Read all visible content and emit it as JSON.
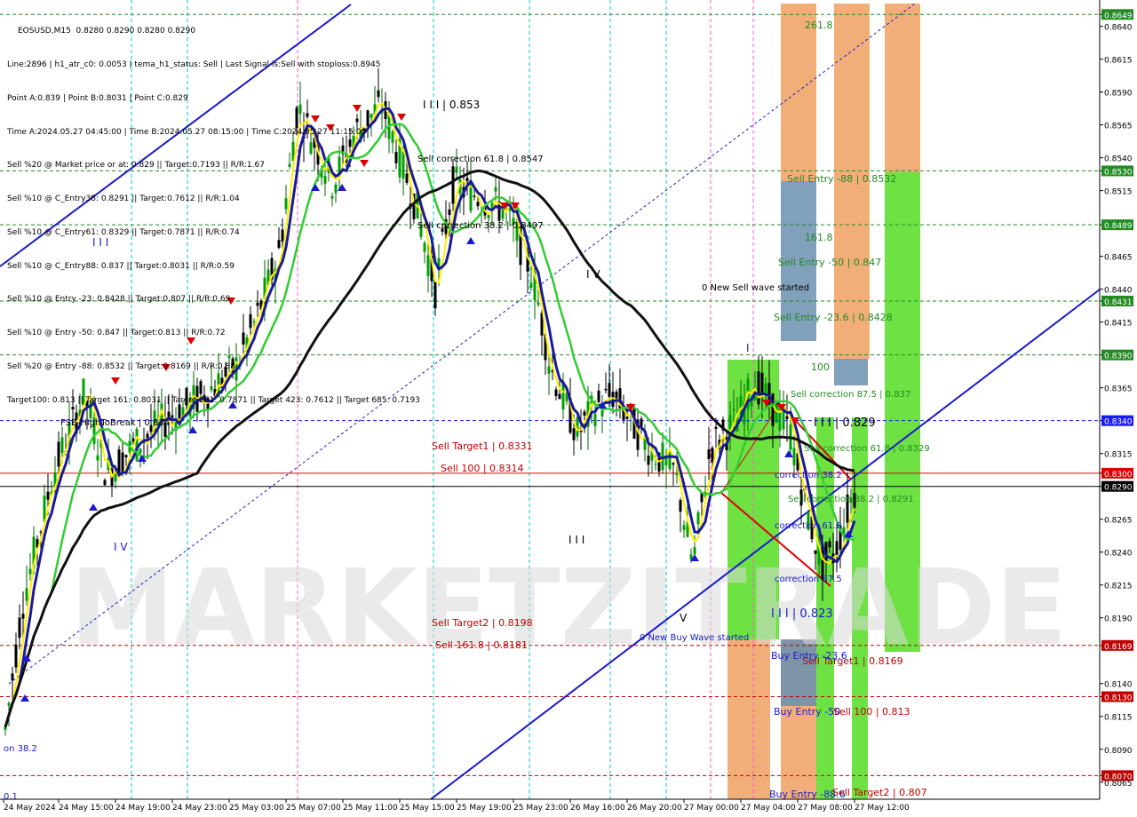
{
  "symbol_header": "EOSUSD,M15  0.8280 0.8290 0.8280 0.8290",
  "info_lines": [
    "Line:2896 | h1_atr_c0: 0.0053 | tema_h1_status: Sell | Last Signal is:Sell with stoploss:0.8945",
    "Point A:0.839 | Point B:0.8031 | Point C:0.829",
    "Time A:2024.05.27 04:45:00 | Time B:2024.05.27 08:15:00 | Time C:2024.05.27 11:15:00",
    "Sell %20 @ Market price or at: 0.829 || Target:0.7193 || R/R:1.67",
    "Sell %10 @ C_Entry38: 0.8291 || Target:0.7612 || R/R:1.04",
    "Sell %10 @ C_Entry61: 0.8329 || Target:0.7871 || R/R:0.74",
    "Sell %10 @ C_Entry88: 0.837 || Target:0.8031 || R/R:0.59",
    "Sell %10 @ Entry -23: 0.8428 || Target:0.807 || R/R:0.69",
    "Sell %10 @ Entry -50: 0.847 || Target:0.813 || R/R:0.72",
    "Sell %20 @ Entry -88: 0.8532 || Target:0.8169 || R/R:0.88",
    "Target100: 0.813 || Target 161: 0.8031 || Target 261: 0.7871 || Target 423: 0.7612 || Target 685: 0.7193"
  ],
  "watermark": "MARKETZITRADE",
  "chart_data": {
    "type": "candlestick",
    "title": "EOSUSD,M15",
    "ylim": [
      0.8052,
      0.866
    ],
    "y_ticks": [
      "0.8649",
      "0.8640",
      "0.8615",
      "0.8590",
      "0.8565",
      "0.8540",
      "0.8530",
      "0.8515",
      "0.8489",
      "0.8465",
      "0.8440",
      "0.8431",
      "0.8415",
      "0.8390",
      "0.8365",
      "0.8340",
      "0.8315",
      "0.8300",
      "0.8290",
      "0.8265",
      "0.8240",
      "0.8215",
      "0.8190",
      "0.8169",
      "0.8140",
      "0.8130",
      "0.8115",
      "0.8090",
      "0.8070",
      "0.8065"
    ],
    "x_ticks": [
      "24 May 2024",
      "24 May 15:00",
      "24 May 19:00",
      "24 May 23:00",
      "25 May 03:00",
      "25 May 07:00",
      "25 May 11:00",
      "25 May 15:00",
      "25 May 19:00",
      "25 May 23:00",
      "26 May 16:00",
      "26 May 20:00",
      "27 May 00:00",
      "27 May 04:00",
      "27 May 08:00",
      "27 May 12:00"
    ],
    "price_levels": [
      {
        "value": 0.8649,
        "color": "#228b22",
        "highlight": true
      },
      {
        "value": 0.853,
        "color": "#228b22",
        "highlight": true
      },
      {
        "value": 0.8489,
        "color": "#228b22",
        "highlight": true
      },
      {
        "value": 0.8431,
        "color": "#228b22",
        "highlight": true
      },
      {
        "value": 0.839,
        "color": "#228b22",
        "highlight": true
      },
      {
        "value": 0.834,
        "color": "#1a1aff",
        "highlight": true
      },
      {
        "value": 0.83,
        "color": "#e00000",
        "highlight": true
      },
      {
        "value": 0.829,
        "color": "#000000",
        "highlight": true
      },
      {
        "value": 0.8169,
        "color": "#c00000",
        "highlight": true
      },
      {
        "value": 0.813,
        "color": "#c00000",
        "highlight": true
      },
      {
        "value": 0.807,
        "color": "#c00000",
        "highlight": true
      }
    ],
    "annotations": [
      {
        "text": "I I I | 0.853",
        "color": "#000000"
      },
      {
        "text": "Sell correction 61.8 | 0.8547",
        "color": "#000000"
      },
      {
        "text": "Sell correction 38.2 | 0.8497",
        "color": "#000000"
      },
      {
        "text": "I I I",
        "color": "#1a1acc"
      },
      {
        "text": "I V",
        "color": "#000000"
      },
      {
        "text": "I V",
        "color": "#1a1acc"
      },
      {
        "text": "I I I",
        "color": "#000000"
      },
      {
        "text": "V",
        "color": "#000000"
      },
      {
        "text": "I",
        "color": "#1a1acc"
      },
      {
        "text": "0 New Sell wave started",
        "color": "#000000"
      },
      {
        "text": "0 New Buy Wave started",
        "color": "#1a1acc"
      },
      {
        "text": "Sell Target1 | 0.8331",
        "color": "#c00000"
      },
      {
        "text": "Sell 100 | 0.8314",
        "color": "#c00000"
      },
      {
        "text": "Sell Target2 | 0.8198",
        "color": "#c00000"
      },
      {
        "text": "Sell 161.8 | 0.8181",
        "color": "#c00000"
      },
      {
        "text": "FSB-HighToBreak | 0.834",
        "color": "#000000"
      },
      {
        "text": "261.8",
        "color": "#228b22"
      },
      {
        "text": "Sell Entry -88 | 0.8532",
        "color": "#228b22"
      },
      {
        "text": "161.8",
        "color": "#228b22"
      },
      {
        "text": "Sell Entry -50 | 0.847",
        "color": "#228b22"
      },
      {
        "text": "Sell Entry -23.6 | 0.8428",
        "color": "#228b22"
      },
      {
        "text": "100",
        "color": "#228b22"
      },
      {
        "text": "Sell correction 87.5 | 0.837",
        "color": "#228b22"
      },
      {
        "text": "I I I | 0.829",
        "color": "#000000"
      },
      {
        "text": "Sell correction 61.8 | 0.8329",
        "color": "#228b22"
      },
      {
        "text": "Sell correction 38.2 | 0.8291",
        "color": "#228b22"
      },
      {
        "text": "correction 38.2",
        "color": "#1a1acc"
      },
      {
        "text": "correction 61.8",
        "color": "#1a1acc"
      },
      {
        "text": "correction 87.5",
        "color": "#1a1acc"
      },
      {
        "text": "I I I | 0.823",
        "color": "#1a1acc"
      },
      {
        "text": "Buy Entry -23.6",
        "color": "#1a1acc"
      },
      {
        "text": "Sell Target1 | 0.8169",
        "color": "#c00000"
      },
      {
        "text": "Buy Entry -50",
        "color": "#1a1acc"
      },
      {
        "text": "Sell 100 | 0.813",
        "color": "#c00000"
      },
      {
        "text": "Buy Entry -88.6",
        "color": "#1a1acc"
      },
      {
        "text": "Sell Target2 | 0.807",
        "color": "#c00000"
      },
      {
        "text": "on 38.2",
        "color": "#1a1acc"
      },
      {
        "text": "0.1",
        "color": "#1a1acc"
      }
    ]
  }
}
